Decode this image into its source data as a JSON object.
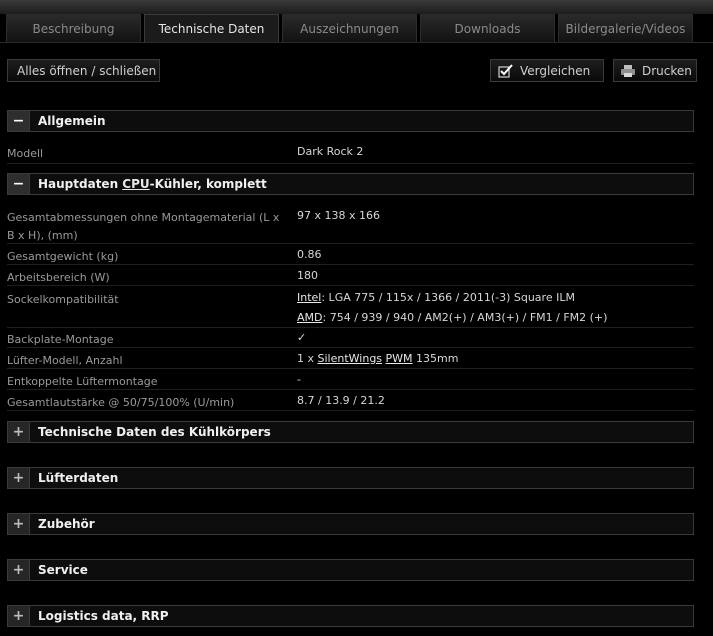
{
  "tabs": [
    {
      "label": "Beschreibung"
    },
    {
      "label": "Technische Daten"
    },
    {
      "label": "Auszeichnungen"
    },
    {
      "label": "Downloads"
    },
    {
      "label": "Bildergalerie/Videos"
    }
  ],
  "toolbar": {
    "toggle_all": "Alles öffnen / schließen",
    "compare": "Vergleichen",
    "print": "Drucken"
  },
  "sections": {
    "allgemein": {
      "title": "Allgemein",
      "toggle": "−"
    },
    "hauptdaten": {
      "title_pre": "Hauptdaten ",
      "title_abbr": "CPU",
      "title_post": "-Kühler, komplett",
      "toggle": "−"
    },
    "kuehlkoerper": {
      "title": "Technische Daten des Kühlkörpers",
      "toggle": "+"
    },
    "luefterdaten": {
      "title": "Lüfterdaten",
      "toggle": "+"
    },
    "zubehoer": {
      "title": "Zubehör",
      "toggle": "+"
    },
    "service": {
      "title": "Service",
      "toggle": "+"
    },
    "logistics": {
      "title": "Logistics data, RRP",
      "toggle": "+"
    }
  },
  "allgemein_rows": {
    "modell": {
      "label": "Modell",
      "value": "Dark Rock 2"
    }
  },
  "hauptdaten_rows": {
    "abmessungen": {
      "label_l1": "Gesamtabmessungen ohne Montagematerial (L x",
      "label_l2": "B x H), (mm)",
      "value": "97 x 138 x 166"
    },
    "gewicht": {
      "label": "Gesamtgewicht (kg)",
      "value": "0.86"
    },
    "arbeitsbereich": {
      "label": "Arbeitsbereich (W)",
      "value": "180"
    },
    "sockel": {
      "label": "Sockelkompatibilität",
      "intel_link": "Intel",
      "intel_value": ": LGA 775 / 115x / 1366 / 2011(-3) Square ILM",
      "amd_link": "AMD",
      "amd_value": ": 754 / 939 / 940 / AM2(+) / AM3(+) / FM1 / FM2 (+)"
    },
    "backplate": {
      "label": "Backplate-Montage",
      "value": "✓"
    },
    "luefter": {
      "label": "Lüfter-Modell, Anzahl",
      "value_pre": "1 x ",
      "link1": "SilentWings",
      "link2": "PWM",
      "value_post": " 135mm"
    },
    "entkoppelt": {
      "label": "Entkoppelte Lüftermontage",
      "value": "-"
    },
    "lautstaerke": {
      "label": "Gesamtlautstärke @ 50/75/100% (U/min)",
      "value": "8.7 / 13.9 / 21.2"
    }
  }
}
